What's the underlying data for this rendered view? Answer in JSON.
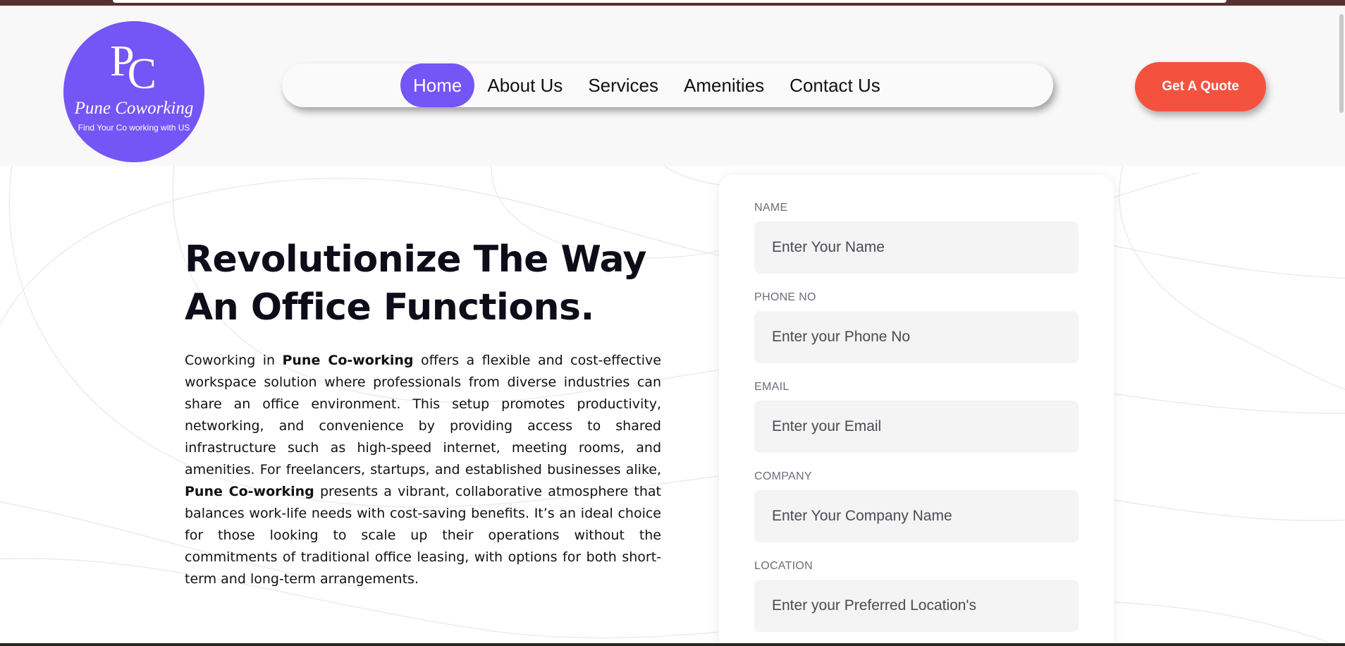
{
  "logo": {
    "monogram_p": "P",
    "monogram_c": "C",
    "brand": "Pune Coworking",
    "tagline": "Find Your Co working with US"
  },
  "nav": {
    "items": [
      {
        "label": "Home",
        "active": true
      },
      {
        "label": "About Us",
        "active": false
      },
      {
        "label": "Services",
        "active": false
      },
      {
        "label": "Amenities",
        "active": false
      },
      {
        "label": "Contact Us",
        "active": false
      }
    ]
  },
  "cta": {
    "label": "Get A Quote"
  },
  "hero": {
    "headline_line1": "Revolutionize The Way",
    "headline_line2": "An Office Functions.",
    "para_1": "Coworking in ",
    "para_bold_1": "Pune Co-working",
    "para_2": " offers a flexible and cost-effective workspace solution where professionals from diverse industries can share an office environment. This setup promotes productivity, networking, and convenience by providing access to shared infrastructure such as high-speed internet, meeting rooms, and amenities. For freelancers, startups, and established businesses alike, ",
    "para_bold_2": "Pune Co-working",
    "para_3": " presents a vibrant, collaborative atmosphere that balances work-life needs with cost-saving benefits. It’s an ideal choice for those looking to scale up their operations without the commitments of traditional office leasing, with options for both short-term and long-term arrangements."
  },
  "form": {
    "fields": [
      {
        "label": "NAME",
        "placeholder": "Enter Your Name"
      },
      {
        "label": "PHONE NO",
        "placeholder": "Enter your Phone No"
      },
      {
        "label": "EMAIL",
        "placeholder": "Enter your Email"
      },
      {
        "label": "COMPANY",
        "placeholder": "Enter Your Company Name"
      },
      {
        "label": "LOCATION",
        "placeholder": "Enter your Preferred Location's"
      }
    ]
  },
  "colors": {
    "brand_purple": "#7455f6",
    "cta_red": "#f4523f",
    "header_bg": "#f8f8f8"
  }
}
